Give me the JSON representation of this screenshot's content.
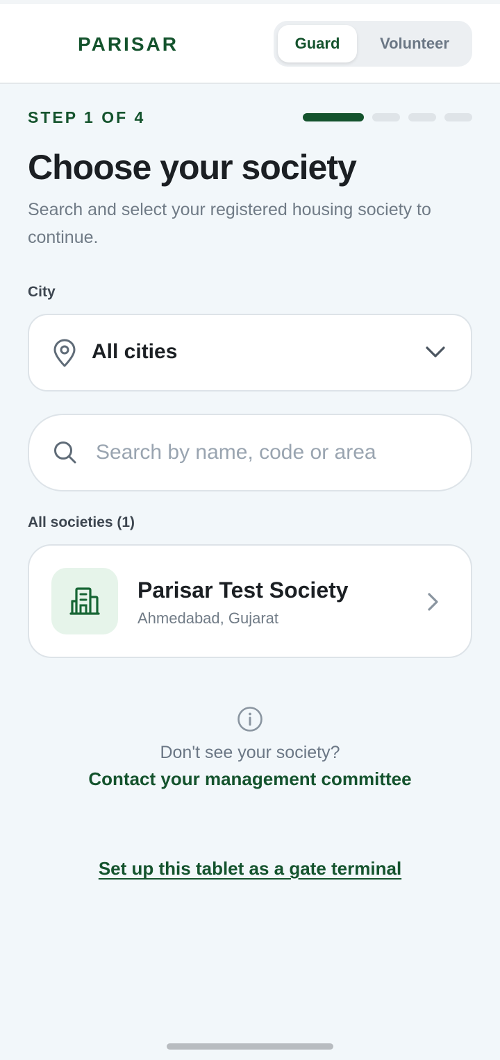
{
  "header": {
    "brand": "PARISAR",
    "roles": [
      "Guard",
      "Volunteer"
    ],
    "active_role": "Guard"
  },
  "step": {
    "label": "STEP 1 OF 4",
    "current": 1,
    "total": 4
  },
  "main": {
    "title": "Choose your society",
    "subtitle": "Search and select your registered housing society to continue."
  },
  "city": {
    "label": "City",
    "value": "All cities",
    "icon": "map-pin-icon"
  },
  "search": {
    "placeholder": "Search by name, code or area",
    "value": "",
    "icon": "search-icon"
  },
  "societies": {
    "label": "All societies (1)",
    "items": [
      {
        "name": "Parisar Test Society",
        "location": "Ahmedabad, Gujarat",
        "icon": "building-icon"
      }
    ]
  },
  "help": {
    "question": "Don't see your society?",
    "action": "Contact your management committee",
    "icon": "info-icon"
  },
  "footer": {
    "gate_link": "Set up this tablet as a gate terminal"
  },
  "colors": {
    "brand": "#14532d",
    "background": "#f2f7fa",
    "muted_text": "#707b86",
    "tile_bg": "#e6f4ea"
  }
}
